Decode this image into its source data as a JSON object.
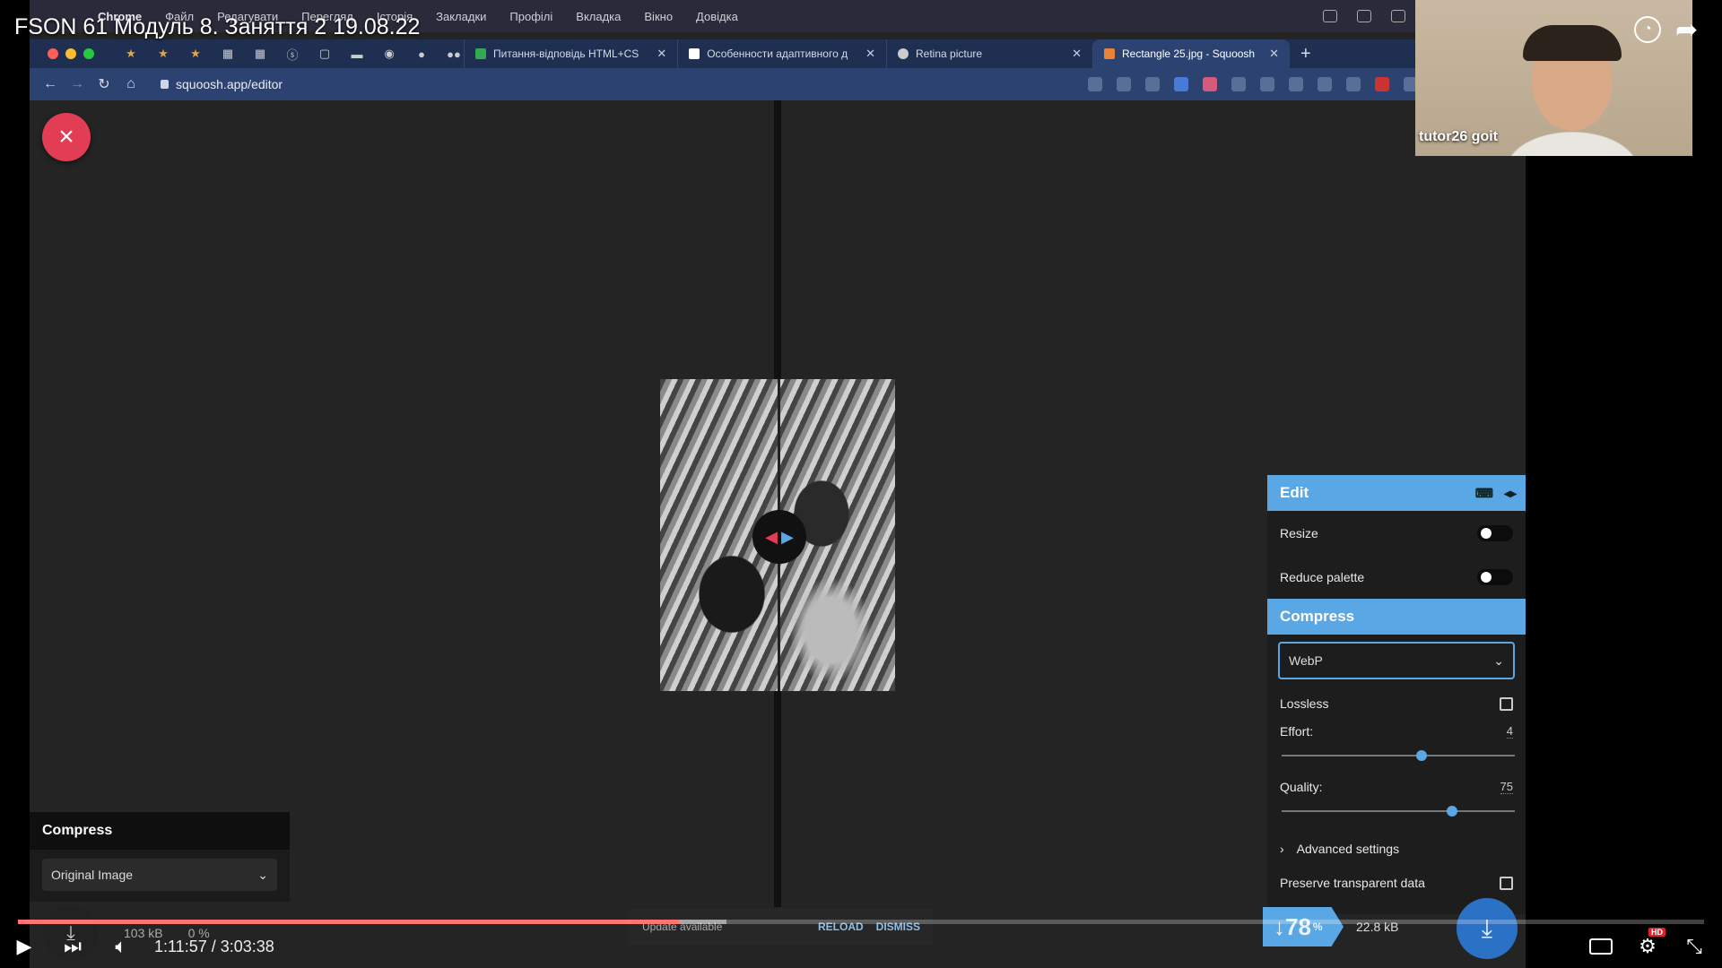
{
  "video": {
    "title": "FSON 61 Модуль 8. Заняття 2 19.08.22",
    "current_time": "1:11:57",
    "duration": "3:03:38",
    "time_separator": " / ",
    "progress_fraction": 0.392
  },
  "menubar": {
    "apple": "",
    "app_name": "Chrome",
    "items": [
      "Файл",
      "Редагувати",
      "Перегляд",
      "Історія",
      "Закладки",
      "Профілі",
      "Вкладка",
      "Вікно",
      "Довідка"
    ]
  },
  "browser": {
    "tabs": [
      {
        "label": "Питання-відповідь HTML+CS",
        "favicon_color": "#34a853",
        "active": false
      },
      {
        "label": "Особенности адаптивного д",
        "favicon_color": "#ffffff",
        "active": false
      },
      {
        "label": "Retina picture",
        "favicon_color": "#cccccc",
        "active": false
      },
      {
        "label": "Rectangle 25.jpg - Squoosh",
        "favicon_color": "#e8833a",
        "active": true
      }
    ],
    "new_tab": "+",
    "url": "squoosh.app/editor"
  },
  "editor": {
    "close_icon": "×",
    "handle_left": "◀",
    "handle_right": "▶",
    "left_panel": {
      "title": "Compress",
      "selected": "Original Image",
      "size": "103 kB",
      "percent": "0 %"
    },
    "right_panel": {
      "edit_title": "Edit",
      "resize_label": "Resize",
      "reduce_palette_label": "Reduce palette",
      "compress_title": "Compress",
      "codec": "WebP",
      "lossless_label": "Lossless",
      "effort_label": "Effort:",
      "effort_value": "4",
      "effort_fraction": 0.6,
      "quality_label": "Quality:",
      "quality_value": "75",
      "quality_fraction": 0.73,
      "advanced_label": "Advanced settings",
      "preserve_label": "Preserve transparent data"
    },
    "result": {
      "arrow": "↓",
      "percent": "78",
      "percent_sign": "%",
      "size": "22.8 kB"
    },
    "snackbar": {
      "text": "Update available",
      "reload": "RELOAD",
      "dismiss": "DISMISS"
    }
  },
  "webcam": {
    "name": "tutor26 goit"
  },
  "colors": {
    "accent_blue": "#5aa7e6",
    "close_red": "#e23d55",
    "progress_red": "#ff0000"
  }
}
